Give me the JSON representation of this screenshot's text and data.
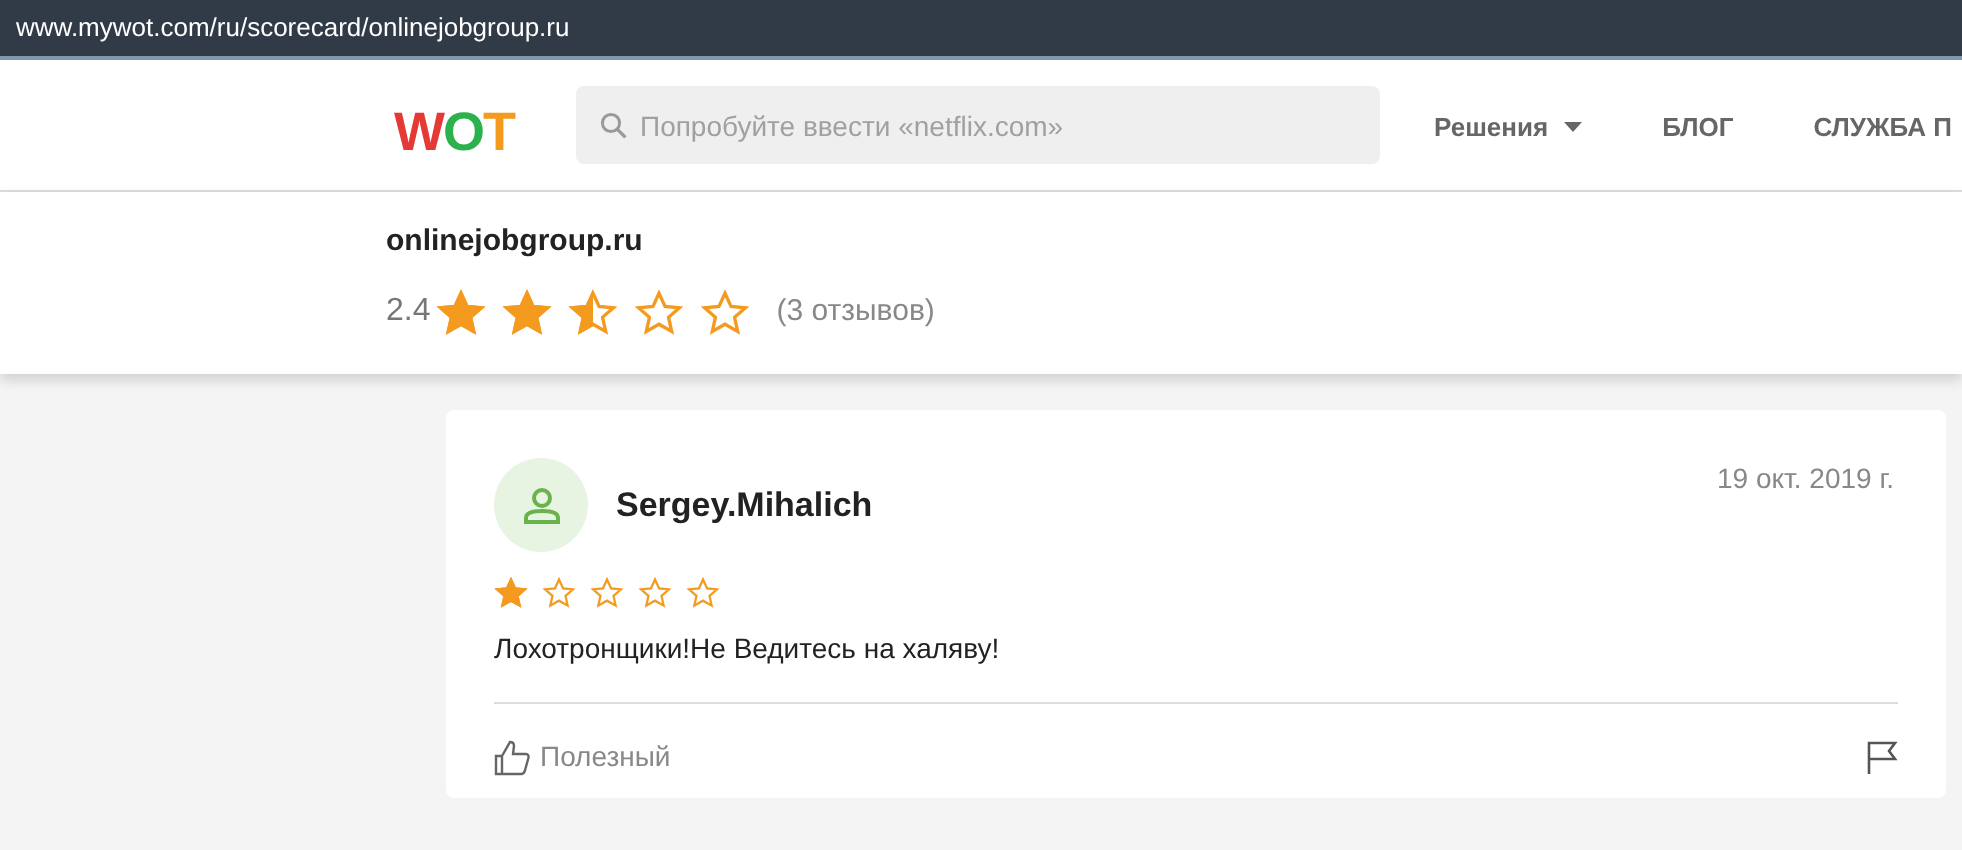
{
  "address_bar": {
    "url": "www.mywot.com/ru/scorecard/onlinejobgroup.ru"
  },
  "header": {
    "logo": [
      "W",
      "O",
      "T"
    ],
    "search": {
      "placeholder": "Попробуйте ввести «netflix.com»"
    },
    "nav": [
      {
        "label": "Решения",
        "dropdown": true
      },
      {
        "label": "БЛОГ",
        "dropdown": false
      },
      {
        "label": "СЛУЖБА П",
        "dropdown": false
      }
    ]
  },
  "site_panel": {
    "domain": "onlinejobgroup.ru",
    "score": "2.4",
    "stars": 2.5,
    "reviews_count": "(3 отзывов)"
  },
  "reviews": [
    {
      "author": "Sergey.Mihalich",
      "date": "19 окт. 2019 г.",
      "stars": 1,
      "text": "Лохотронщики!Не Ведитесь на халяву!",
      "helpful": "Полезный"
    }
  ]
}
